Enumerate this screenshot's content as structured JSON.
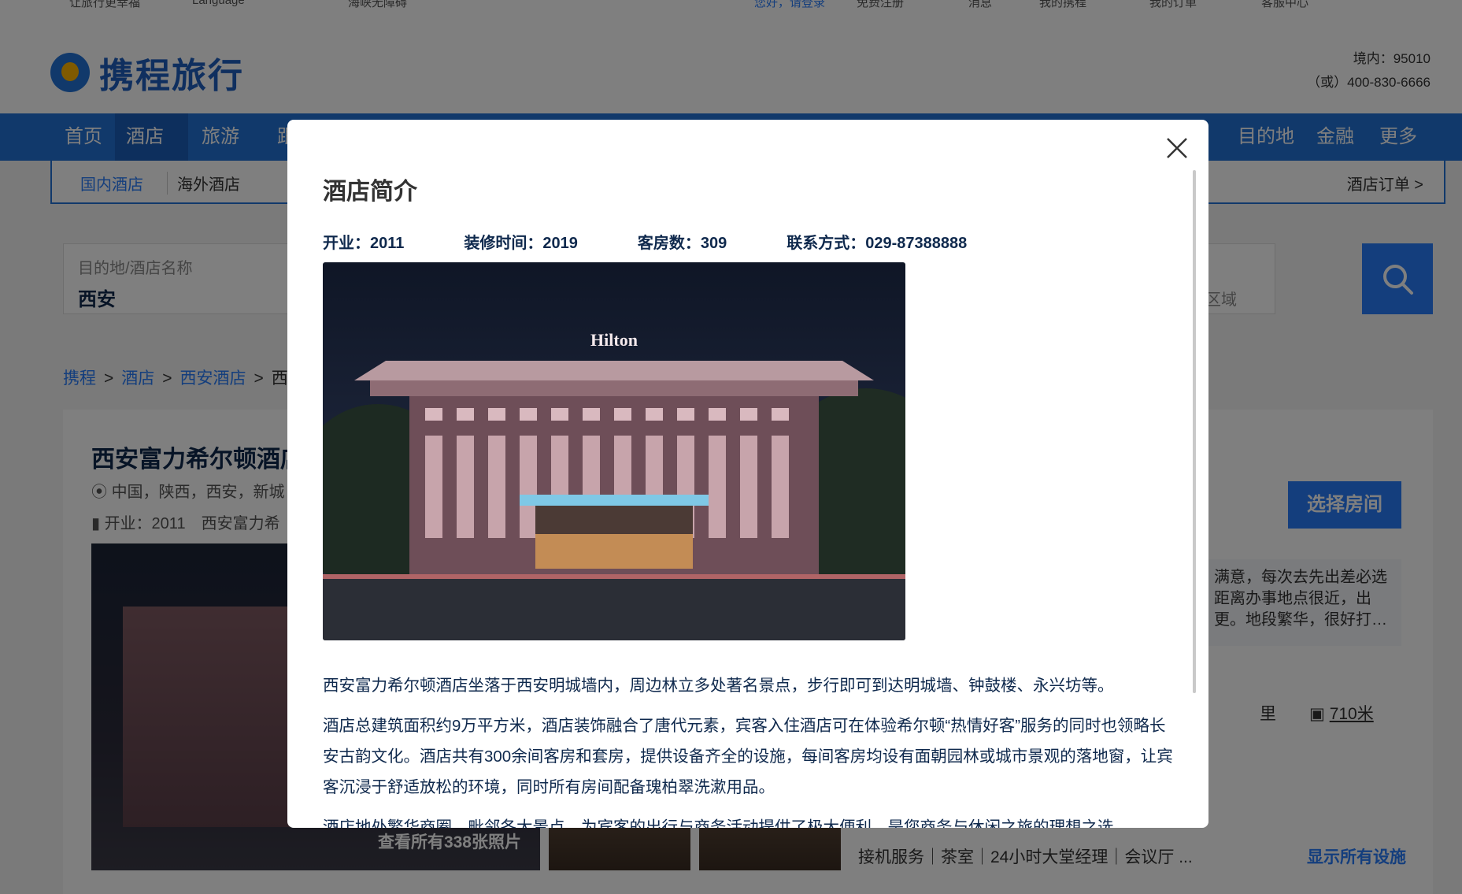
{
  "topbar": {
    "left1": "让旅行更幸福",
    "left2": "Language",
    "left3": "海峡无障碍",
    "greeting": "您好，请登录",
    "register": "免费注册",
    "messages": "消息",
    "my_ctrip": "我的携程",
    "my_orders": "我的订单",
    "service": "客服中心"
  },
  "header": {
    "logo_text": "携程旅行",
    "hotline_1": "境内：95010",
    "hotline_2": "（或）400-830-6666"
  },
  "nav": {
    "items": [
      "首页",
      "酒店",
      "旅游",
      "跟",
      "目的地",
      "金融",
      "更多"
    ]
  },
  "subnav": {
    "domestic": "国内酒店",
    "overseas": "海外酒店",
    "orders": "酒店订单 >"
  },
  "search": {
    "label": "目的地/酒店名称",
    "value": "西安",
    "area_hint": "区域"
  },
  "breadcrumb": [
    "携程",
    "酒店",
    "西安酒店",
    "西"
  ],
  "hotel": {
    "name": "西安富力希尔顿酒店",
    "address": "中国，陕西，西安，新城",
    "opening": "开业：2011　西安富力希",
    "all_photos": "查看所有338张照片",
    "select_room": "选择房间",
    "review": "满意，每次去先出差必选　距离办事地点很近，出　更。地段繁华，很好打…",
    "distance_1": "里",
    "distance_2": "710米",
    "facilities": "接机服务｜茶室｜24小时大堂经理｜会议厅 ...",
    "show_facilities": "显示所有设施"
  },
  "modal": {
    "title": "酒店简介",
    "facts": {
      "opened": "开业：2011",
      "renovated": "装修时间：2019",
      "rooms": "客房数：309",
      "contact": "联系方式：029-87388888"
    },
    "photo_sign": "Hilton",
    "paragraphs": [
      "西安富力希尔顿酒店坐落于西安明城墙内，周边林立多处著名景点，步行即可到达明城墙、钟鼓楼、永兴坊等。",
      "酒店总建筑面积约9万平方米，酒店装饰融合了唐代元素，宾客入住酒店可在体验希尔顿“热情好客”服务的同时也领略长安古韵文化。酒店共有300余间客房和套房，提供设备齐全的设施，每间客房均设有面朝园林或城市景观的落地窗，让宾客沉浸于舒适放松的环境，同时所有房间配备瑰柏翠洗漱用品。",
      "酒店地处繁华商圈，毗邻各大景点，为宾客的出行与商务活动提供了极大便利，是您商务与休闲之旅的理想之选。"
    ]
  },
  "colors": {
    "brand_blue": "#2273d6",
    "accent_blue": "#287dfa",
    "text_dark": "#0f294d"
  }
}
